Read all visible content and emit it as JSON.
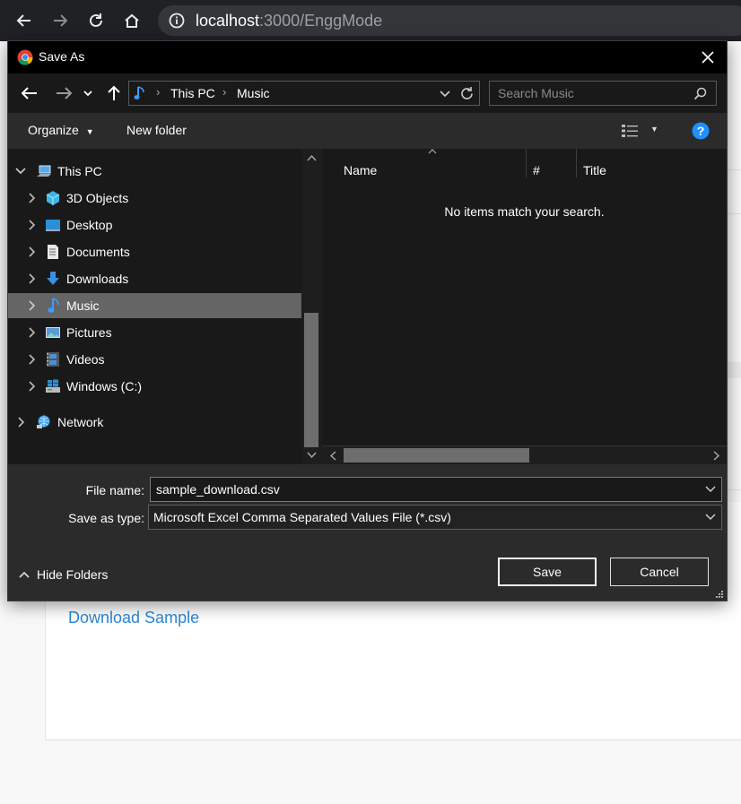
{
  "browser": {
    "url_host": "localhost",
    "url_path": ":3000/EnggMode"
  },
  "page": {
    "download_link": "Download Sample"
  },
  "dialog": {
    "title": "Save As",
    "address": {
      "segments": [
        "This PC",
        "Music"
      ]
    },
    "search": {
      "placeholder": "Search Music"
    },
    "toolbar": {
      "organize": "Organize",
      "new_folder": "New folder"
    },
    "tree": [
      {
        "label": "This PC",
        "icon": "computer-icon",
        "expanded": true
      },
      {
        "label": "3D Objects",
        "icon": "cube-icon"
      },
      {
        "label": "Desktop",
        "icon": "desktop-icon"
      },
      {
        "label": "Documents",
        "icon": "document-icon"
      },
      {
        "label": "Downloads",
        "icon": "download-arrow-icon"
      },
      {
        "label": "Music",
        "icon": "music-note-icon",
        "selected": true
      },
      {
        "label": "Pictures",
        "icon": "picture-icon"
      },
      {
        "label": "Videos",
        "icon": "film-icon"
      },
      {
        "label": "Windows (C:)",
        "icon": "drive-icon"
      },
      {
        "label": "Network",
        "icon": "network-icon"
      }
    ],
    "columns": [
      "Name",
      "#",
      "Title"
    ],
    "empty_message": "No items match your search.",
    "file_name_label": "File name:",
    "file_name_value": "sample_download.csv",
    "save_type_label": "Save as type:",
    "save_type_value": "Microsoft Excel Comma Separated Values File (*.csv)",
    "save_button": "Save",
    "cancel_button": "Cancel",
    "hide_folders": "Hide Folders"
  },
  "colors": {
    "dialog_bg": "#2b2b2b",
    "pane_bg": "#191919",
    "selected_bg": "#656565",
    "link": "#2f86d6",
    "help_blue": "#1e90ff"
  }
}
